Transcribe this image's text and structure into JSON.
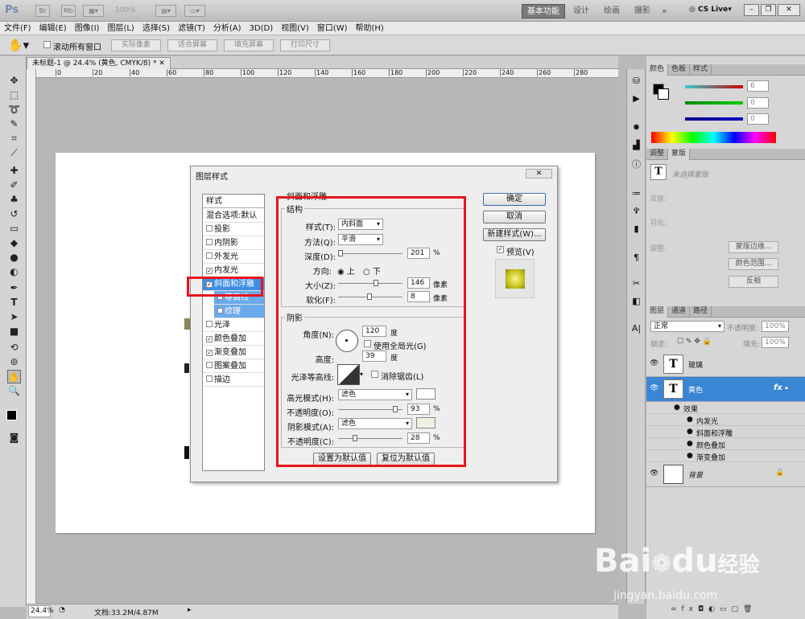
{
  "app": {
    "logo": "Ps",
    "zoom_display": "100%",
    "workspaces": [
      "基本功能",
      "设计",
      "绘画",
      "摄影"
    ],
    "cslive": "CS Live"
  },
  "menu": [
    "文件(F)",
    "编辑(E)",
    "图像(I)",
    "图层(L)",
    "选择(S)",
    "滤镜(T)",
    "分析(A)",
    "3D(D)",
    "视图(V)",
    "窗口(W)",
    "帮助(H)"
  ],
  "options": {
    "scroll_all": "滚动所有窗口",
    "actual_pixels": "实际像素",
    "fit_screen": "适合屏幕",
    "fill_screen": "填充屏幕",
    "print_size": "打印尺寸"
  },
  "document": {
    "tab": "未标题-1 @ 24.4% (黄色, CMYK/8) *",
    "zoom": "24.4%",
    "doc_size": "文档:33.2M/4.87M",
    "ruler_ticks": [
      "0",
      "20",
      "40",
      "60",
      "80",
      "100",
      "120",
      "140",
      "160",
      "180",
      "200",
      "220",
      "240",
      "260",
      "280"
    ]
  },
  "panels": {
    "color": {
      "tabs": [
        "颜色",
        "色板",
        "样式"
      ],
      "values": [
        "6",
        "0",
        "0"
      ],
      "letters": [
        "C",
        "M",
        "Y"
      ]
    },
    "adjust": {
      "tabs": [
        "调整",
        "蒙版"
      ],
      "hint": "未选择蒙版",
      "density": "浓度:",
      "feather": "羽化:",
      "refine": "调整:",
      "btn_edge": "蒙版边缘...",
      "btn_range": "颜色范围...",
      "btn_invert": "反相"
    },
    "layers": {
      "tabs": [
        "图层",
        "通道",
        "路径"
      ],
      "blend": "正常",
      "opacity_label": "不透明度:",
      "opacity": "100%",
      "lock_label": "锁定:",
      "fill_label": "填充:",
      "fill": "100%",
      "items": [
        {
          "name": "玻璃"
        },
        {
          "name": "黄色"
        },
        {
          "name": "背景"
        }
      ],
      "effects_label": "效果",
      "effects": [
        "内发光",
        "斜面和浮雕",
        "颜色叠加",
        "渐变叠加"
      ]
    }
  },
  "dialog": {
    "title": "图层样式",
    "styles_header": "样式",
    "blend_options": "混合选项:默认",
    "styles": [
      {
        "label": "投影",
        "checked": false
      },
      {
        "label": "内阴影",
        "checked": false
      },
      {
        "label": "外发光",
        "checked": false
      },
      {
        "label": "内发光",
        "checked": true
      },
      {
        "label": "斜面和浮雕",
        "checked": true
      },
      {
        "label": "等高线",
        "checked": false
      },
      {
        "label": "纹理",
        "checked": false
      },
      {
        "label": "光泽",
        "checked": false
      },
      {
        "label": "颜色叠加",
        "checked": true
      },
      {
        "label": "渐变叠加",
        "checked": true
      },
      {
        "label": "图案叠加",
        "checked": false
      },
      {
        "label": "描边",
        "checked": false
      }
    ],
    "bevel": {
      "header": "斜面和浮雕",
      "structure": "结构",
      "style_label": "样式(T):",
      "style_value": "内斜面",
      "technique_label": "方法(Q):",
      "technique_value": "平滑",
      "depth_label": "深度(D):",
      "depth": "201",
      "depth_unit": "%",
      "direction_label": "方向:",
      "dir_up": "上",
      "dir_down": "下",
      "size_label": "大小(Z):",
      "size": "146",
      "size_unit": "像素",
      "soften_label": "软化(F):",
      "soften": "8",
      "soften_unit": "像素"
    },
    "shading": {
      "header": "阴影",
      "angle_label": "角度(N):",
      "angle": "120",
      "angle_unit": "度",
      "global_light": "使用全局光(G)",
      "altitude_label": "高度:",
      "altitude": "39",
      "altitude_unit": "度",
      "gloss_label": "光泽等高线:",
      "antialias": "消除锯齿(L)",
      "highlight_label": "高光模式(H):",
      "highlight_mode": "滤色",
      "hl_opacity_label": "不透明度(O):",
      "hl_opacity": "93",
      "hl_unit": "%",
      "shadow_label": "阴影模式(A):",
      "shadow_mode": "滤色",
      "sh_opacity_label": "不透明度(C):",
      "sh_opacity": "28",
      "sh_unit": "%"
    },
    "buttons": {
      "ok": "确定",
      "cancel": "取消",
      "new_style": "新建样式(W)...",
      "preview": "预览(V)",
      "set_default": "设置为默认值",
      "reset_default": "复位为默认值"
    },
    "colors": {
      "highlight": "#ffffff",
      "shadow": "#eef3df"
    }
  },
  "watermark": {
    "brand": "Bai",
    "brand2": "经验",
    "site": "jingyan.baidu.com"
  }
}
